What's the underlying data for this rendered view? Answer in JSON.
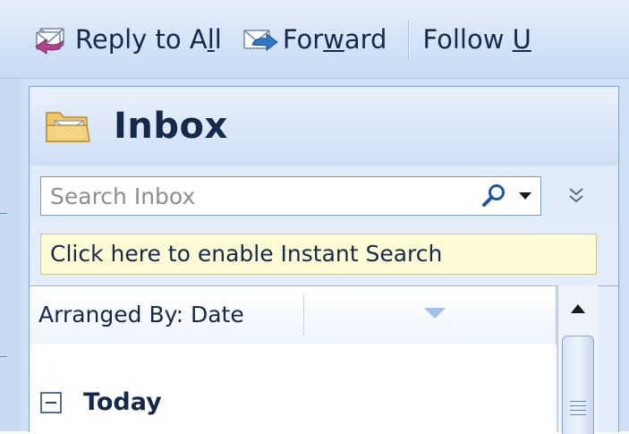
{
  "toolbar": {
    "reply_all": {
      "label_pre": "Reply to A",
      "label_ul": "l",
      "label_post": "l",
      "icon": "reply-all-icon"
    },
    "forward": {
      "label_pre": "For",
      "label_ul": "w",
      "label_post": "ard",
      "icon": "forward-icon"
    },
    "follow_up": {
      "label_pre": "Follow ",
      "label_ul": "U"
    }
  },
  "folder": {
    "title": "Inbox",
    "icon": "inbox-folder-icon"
  },
  "search": {
    "placeholder": "Search Inbox",
    "value": "",
    "search_icon": "magnifier-icon",
    "dropdown_icon": "triangle-down-icon",
    "expand_icon": "double-chevron-down-icon"
  },
  "instant_search": {
    "text": "Click here to enable Instant Search"
  },
  "arrange": {
    "label": "Arranged By: Date"
  },
  "groups": [
    {
      "label": "Today",
      "expanded": true
    }
  ],
  "colors": {
    "toolbar_bg": "#d4e3f7",
    "pane_bg": "#cfe0f6",
    "instant_bg": "#fdfbd5",
    "text": "#15294a"
  }
}
